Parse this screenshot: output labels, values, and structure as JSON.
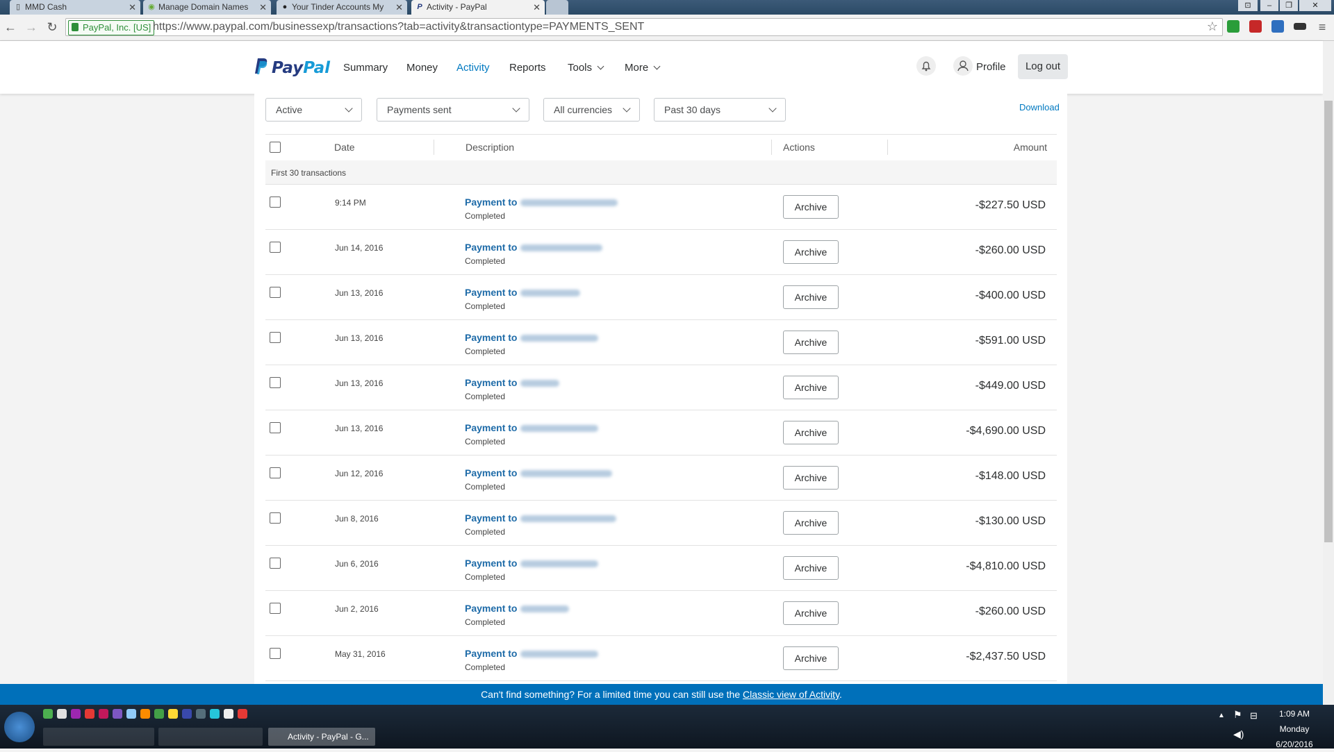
{
  "browser": {
    "tabs": [
      {
        "title": "MMD Cash",
        "active": false
      },
      {
        "title": "Manage Domain Names",
        "active": false
      },
      {
        "title": "Your Tinder Accounts My",
        "active": false
      },
      {
        "title": "Activity - PayPal",
        "active": true
      }
    ],
    "ev_badge": "PayPal, Inc. [US]",
    "url": "https://www.paypal.com/businessexp/transactions?tab=activity&transactiontype=PAYMENTS_SENT"
  },
  "header": {
    "logo": {
      "pay": "Pay",
      "pal": "Pal"
    },
    "nav": [
      "Summary",
      "Money",
      "Activity",
      "Reports",
      "Tools",
      "More"
    ],
    "active_nav": "Activity",
    "profile": "Profile",
    "logout": "Log out"
  },
  "filters": {
    "status": "Active",
    "type": "Payments sent",
    "currency": "All currencies",
    "period": "Past 30 days",
    "download": "Download"
  },
  "table": {
    "headers": {
      "date": "Date",
      "description": "Description",
      "actions": "Actions",
      "amount": "Amount"
    },
    "group_label": "First 30 transactions",
    "rows": [
      {
        "date": "9:14 PM",
        "description": "Payment to",
        "status": "Completed",
        "action": "Archive",
        "amount": "-$227.50 USD"
      },
      {
        "date": "Jun 14, 2016",
        "description": "Payment to",
        "status": "Completed",
        "action": "Archive",
        "amount": "-$260.00 USD"
      },
      {
        "date": "Jun 13, 2016",
        "description": "Payment to",
        "status": "Completed",
        "action": "Archive",
        "amount": "-$400.00 USD"
      },
      {
        "date": "Jun 13, 2016",
        "description": "Payment to",
        "status": "Completed",
        "action": "Archive",
        "amount": "-$591.00 USD"
      },
      {
        "date": "Jun 13, 2016",
        "description": "Payment to",
        "status": "Completed",
        "action": "Archive",
        "amount": "-$449.00 USD"
      },
      {
        "date": "Jun 13, 2016",
        "description": "Payment to",
        "status": "Completed",
        "action": "Archive",
        "amount": "-$4,690.00 USD"
      },
      {
        "date": "Jun 12, 2016",
        "description": "Payment to",
        "status": "Completed",
        "action": "Archive",
        "amount": "-$148.00 USD"
      },
      {
        "date": "Jun 8, 2016",
        "description": "Payment to",
        "status": "Completed",
        "action": "Archive",
        "amount": "-$130.00 USD"
      },
      {
        "date": "Jun 6, 2016",
        "description": "Payment to",
        "status": "Completed",
        "action": "Archive",
        "amount": "-$4,810.00 USD"
      },
      {
        "date": "Jun 2, 2016",
        "description": "Payment to",
        "status": "Completed",
        "action": "Archive",
        "amount": "-$260.00 USD"
      },
      {
        "date": "May 31, 2016",
        "description": "Payment to",
        "status": "Completed",
        "action": "Archive",
        "amount": "-$2,437.50 USD"
      }
    ]
  },
  "banner": {
    "text": "Can't find something? For a limited time you can still use the",
    "link": "Classic view of Activity",
    "suffix": "."
  },
  "taskbar": {
    "active_window": "Activity - PayPal - G...",
    "time": "1:09 AM",
    "day": "Monday",
    "date": "6/20/2016"
  },
  "colors": {
    "paypal_blue": "#0079c1",
    "brand_dark": "#253b80",
    "banner": "#0070ba"
  }
}
